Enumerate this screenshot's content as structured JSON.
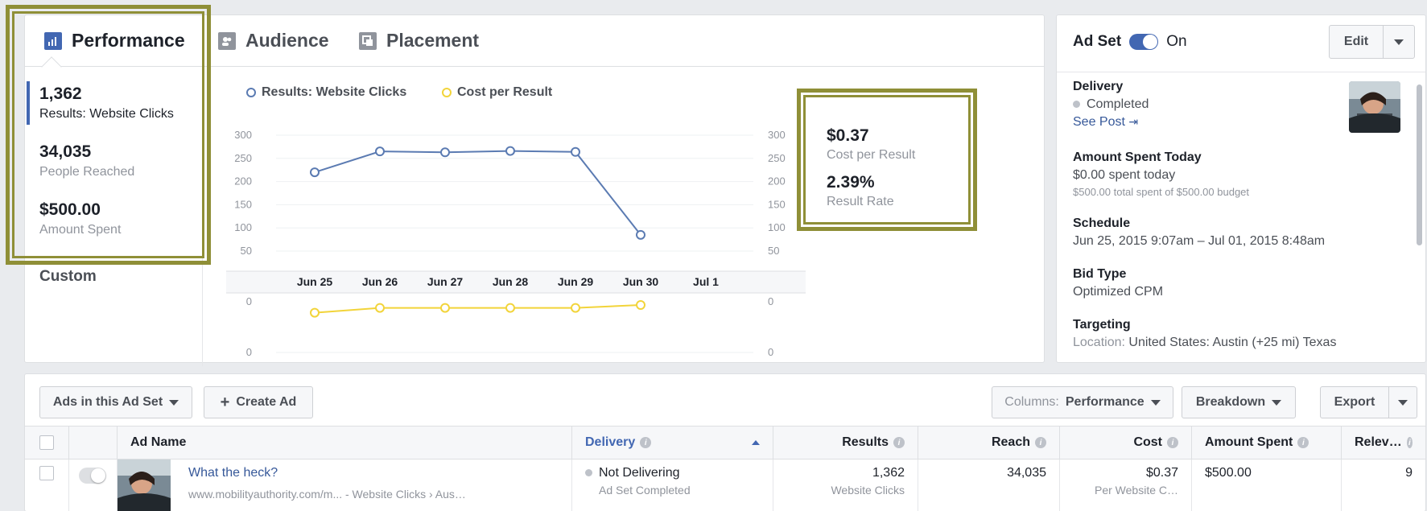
{
  "tabs": [
    {
      "label": "Performance",
      "icon": "bar-chart-icon"
    },
    {
      "label": "Audience",
      "icon": "people-icon"
    },
    {
      "label": "Placement",
      "icon": "placement-icon"
    }
  ],
  "stats": [
    {
      "value": "1,362",
      "label": "Results: Website Clicks"
    },
    {
      "value": "34,035",
      "label": "People Reached"
    },
    {
      "value": "$500.00",
      "label": "Amount Spent"
    }
  ],
  "custom_label": "Custom",
  "legend": [
    {
      "label": "Results: Website Clicks",
      "color": "#5b7bb2"
    },
    {
      "label": "Cost per Result",
      "color": "#f2d43a"
    }
  ],
  "kpis": [
    {
      "value": "$0.37",
      "label": "Cost per Result"
    },
    {
      "value": "2.39%",
      "label": "Result Rate"
    }
  ],
  "chart_data": {
    "type": "line",
    "x": [
      "Jun 25",
      "Jun 26",
      "Jun 27",
      "Jun 28",
      "Jun 29",
      "Jun 30",
      "Jul 1"
    ],
    "series": [
      {
        "name": "Results: Website Clicks",
        "values": [
          220,
          265,
          263,
          266,
          264,
          85,
          null
        ],
        "color": "#5b7bb2"
      },
      {
        "name": "Cost per Result",
        "values": [
          -0.4,
          -0.15,
          -0.15,
          -0.15,
          -0.15,
          0.0,
          null
        ],
        "color": "#f2d43a"
      }
    ],
    "upper_yticks": [
      "300",
      "250",
      "200",
      "150",
      "100",
      "50"
    ],
    "lower_yticks": [
      "0",
      "0"
    ],
    "ylim": [
      50,
      300
    ]
  },
  "adset": {
    "title": "Ad Set",
    "status": "On",
    "edit_label": "Edit",
    "delivery_h": "Delivery",
    "delivery_v": "Completed",
    "see_post": "See Post",
    "spent_h": "Amount Spent Today",
    "spent_v": "$0.00 spent today",
    "spent_s": "$500.00 total spent of $500.00 budget",
    "schedule_h": "Schedule",
    "schedule_v": "Jun 25, 2015 9:07am – Jul 01, 2015 8:48am",
    "bid_h": "Bid Type",
    "bid_v": "Optimized CPM",
    "targeting_h": "Targeting",
    "targeting_k": "Location:",
    "targeting_v": " United States: Austin (+25 mi) Texas"
  },
  "toolbar": {
    "ads_filter": "Ads in this Ad Set",
    "create_ad": "Create Ad",
    "columns_prefix": "Columns:",
    "columns_value": "Performance",
    "breakdown": "Breakdown",
    "export": "Export"
  },
  "table": {
    "headers": {
      "ad_name": "Ad Name",
      "delivery": "Delivery",
      "results": "Results",
      "reach": "Reach",
      "cost": "Cost",
      "amount_spent": "Amount Spent",
      "relevance": "Relev…"
    },
    "row": {
      "name": "What the heck?",
      "url": "www.mobilityauthority.com/m... - Website Clicks",
      "url_tail": "Aus…",
      "delivery": "Not Delivering",
      "delivery_sub": "Ad Set Completed",
      "results": "1,362",
      "results_sub": "Website Clicks",
      "reach": "34,035",
      "cost": "$0.37",
      "cost_sub": "Per Website C…",
      "amount": "$500.00",
      "relevance": "9"
    }
  },
  "colors": {
    "accent": "#4267b2",
    "highlight": "#8f8f37",
    "link": "#365899"
  }
}
